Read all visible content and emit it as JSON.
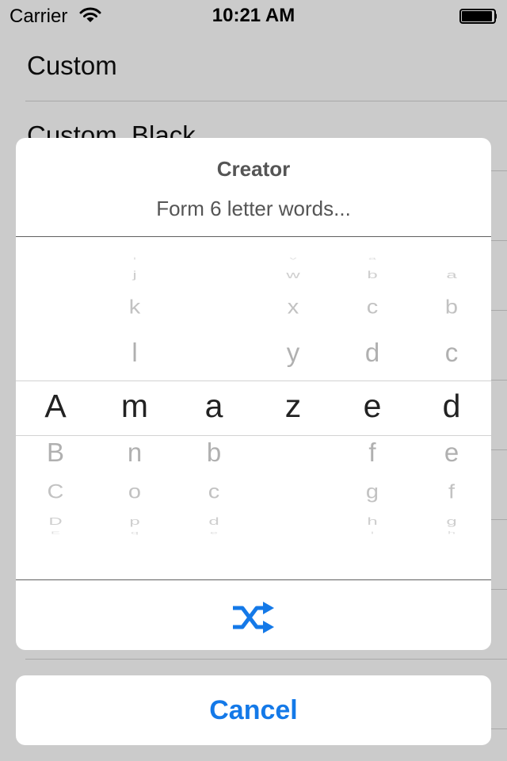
{
  "status_bar": {
    "carrier": "Carrier",
    "time": "10:21 AM"
  },
  "background_list": {
    "items": [
      "Custom",
      "Custom_Black",
      "",
      "",
      "",
      "",
      "",
      "",
      "",
      ""
    ]
  },
  "action_sheet": {
    "title": "Creator",
    "message": "Form 6 letter words...",
    "picker": {
      "columns": [
        {
          "above": [
            "",
            "",
            "",
            ""
          ],
          "selected": "A",
          "below": [
            "B",
            "C",
            "D",
            "E"
          ]
        },
        {
          "above": [
            "i",
            "j",
            "k",
            "l"
          ],
          "selected": "m",
          "below": [
            "n",
            "o",
            "p",
            "q"
          ]
        },
        {
          "above": [
            "",
            "",
            "",
            ""
          ],
          "selected": "a",
          "below": [
            "b",
            "c",
            "d",
            "e"
          ]
        },
        {
          "above": [
            "v",
            "w",
            "x",
            "y"
          ],
          "selected": "z",
          "below": [
            "",
            "",
            "",
            ""
          ]
        },
        {
          "above": [
            "a",
            "b",
            "c",
            "d"
          ],
          "selected": "e",
          "below": [
            "f",
            "g",
            "h",
            "i"
          ]
        },
        {
          "above": [
            "",
            "a",
            "b",
            "c"
          ],
          "selected": "d",
          "below": [
            "e",
            "f",
            "g",
            "h"
          ]
        }
      ]
    },
    "shuffle_icon": "shuffle-icon",
    "accent_color": "#1479e8"
  },
  "cancel_button": {
    "label": "Cancel"
  }
}
